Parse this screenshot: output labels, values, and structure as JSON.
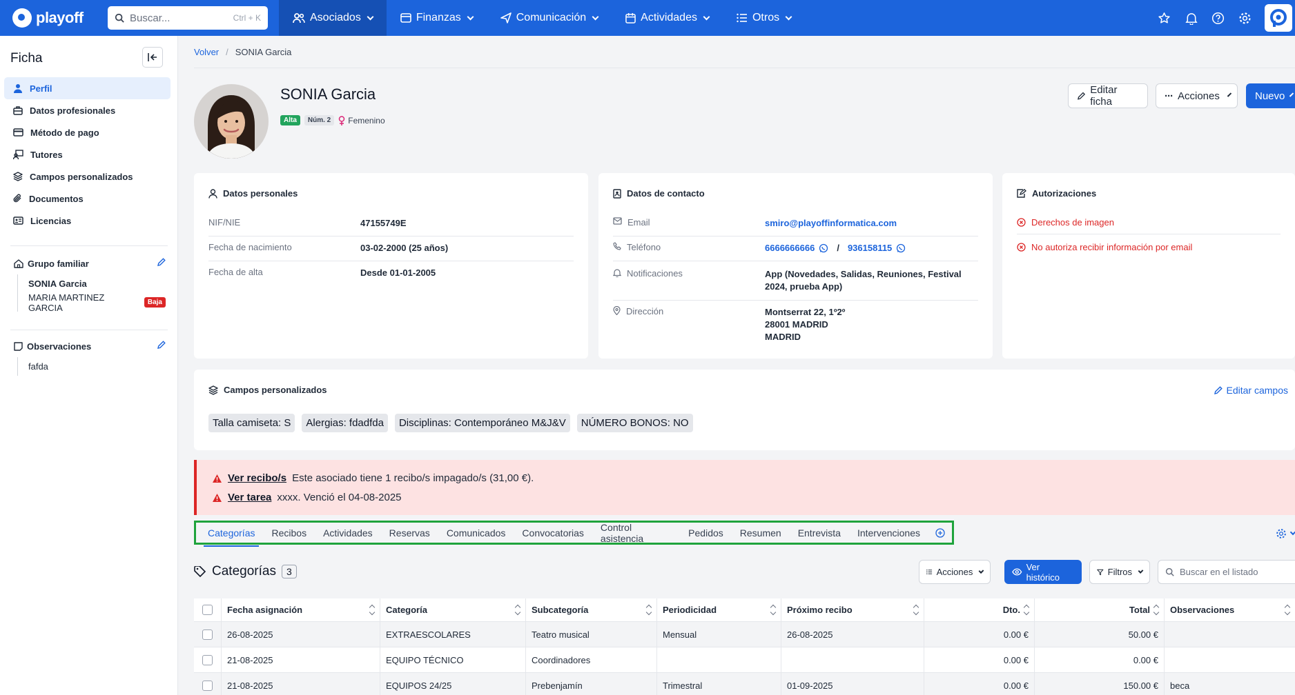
{
  "brand": {
    "name": "playoff"
  },
  "search": {
    "placeholder": "Buscar...",
    "shortcut": "Ctrl + K"
  },
  "nav": [
    {
      "label": "Asociados",
      "active": true
    },
    {
      "label": "Finanzas"
    },
    {
      "label": "Comunicación"
    },
    {
      "label": "Actividades"
    },
    {
      "label": "Otros"
    }
  ],
  "sidebar": {
    "title": "Ficha",
    "items": [
      {
        "label": "Perfil",
        "icon": "user-icon",
        "active": true
      },
      {
        "label": "Datos profesionales",
        "icon": "briefcase-icon"
      },
      {
        "label": "Método de pago",
        "icon": "credit-card-icon"
      },
      {
        "label": "Tutores",
        "icon": "tutor-icon"
      },
      {
        "label": "Campos personalizados",
        "icon": "layers-icon"
      },
      {
        "label": "Documentos",
        "icon": "paperclip-icon"
      },
      {
        "label": "Licencias",
        "icon": "id-card-icon"
      }
    ],
    "family": {
      "title": "Grupo familiar",
      "members": [
        {
          "name": "SONIA Garcia",
          "bold": true
        },
        {
          "name": "MARIA MARTINEZ GARCIA",
          "badge": "Baja"
        }
      ]
    },
    "notes": {
      "title": "Observaciones",
      "items": [
        "fafda"
      ]
    }
  },
  "breadcrumb": {
    "back": "Volver",
    "current": "SONIA Garcia"
  },
  "profile": {
    "name": "SONIA Garcia",
    "status": "Alta",
    "number": "Núm. 2",
    "gender": "Femenino"
  },
  "actions": {
    "edit": "Editar ficha",
    "more": "Acciones",
    "new": "Nuevo"
  },
  "personal": {
    "title": "Datos personales",
    "rows": [
      {
        "k": "NIF/NIE",
        "v": "47155749E"
      },
      {
        "k": "Fecha de nacimiento",
        "v": "03-02-2000 (25 años)"
      },
      {
        "k": "Fecha de alta",
        "v": "Desde 01-01-2005"
      }
    ]
  },
  "contact": {
    "title": "Datos de contacto",
    "email_k": "Email",
    "email_v": "smiro@playoffinformatica.com",
    "phone_k": "Teléfono",
    "phone1": "6666666666",
    "phone_sep": "/",
    "phone2": "936158115",
    "notif_k": "Notificaciones",
    "notif_v": "App (Novedades, Salidas, Reuniones, Festival 2024, prueba App)",
    "addr_k": "Dirección",
    "addr1": "Montserrat 22, 1º2º",
    "addr2": "28001 MADRID",
    "addr3": "MADRID"
  },
  "auth": {
    "title": "Autorizaciones",
    "items": [
      "Derechos de imagen",
      "No autoriza recibir información por email"
    ]
  },
  "custom": {
    "title": "Campos personalizados",
    "edit": "Editar campos",
    "chips": [
      "Talla camiseta: S",
      "Alergias: fdadfda",
      "Disciplinas: Contemporáneo M&J&V",
      "NÚMERO BONOS: NO"
    ]
  },
  "alerts": [
    {
      "link": "Ver recibo/s",
      "text": "Este asociado tiene 1 recibo/s impagado/s (31,00 €)."
    },
    {
      "link": "Ver tarea",
      "text": "xxxx. Venció el 04-08-2025"
    }
  ],
  "tabs": [
    "Categorías",
    "Recibos",
    "Actividades",
    "Reservas",
    "Comunicados",
    "Convocatorias",
    "Control asistencia",
    "Pedidos",
    "Resumen",
    "Entrevista",
    "Intervenciones"
  ],
  "section": {
    "title": "Categorías",
    "count": "3",
    "actions": "Acciones",
    "history": "Ver histórico",
    "filters": "Filtros",
    "search_placeholder": "Buscar en el listado"
  },
  "table": {
    "headers": [
      "Fecha asignación",
      "Categoría",
      "Subcategoría",
      "Periodicidad",
      "Próximo recibo",
      "Dto.",
      "Total",
      "Observaciones"
    ],
    "rows": [
      [
        "26-08-2025",
        "EXTRAESCOLARES",
        "Teatro musical",
        "Mensual",
        "26-08-2025",
        "0.00 €",
        "50.00 €",
        ""
      ],
      [
        "21-08-2025",
        "EQUIPO TÉCNICO",
        "Coordinadores",
        "",
        "",
        "0.00 €",
        "0.00 €",
        ""
      ],
      [
        "21-08-2025",
        "EQUIPOS 24/25",
        "Prebenjamín",
        "Trimestral",
        "01-09-2025",
        "0.00 €",
        "150.00 €",
        "beca"
      ]
    ]
  },
  "colors": {
    "primary": "#1c64dc",
    "success": "#22a45d",
    "danger": "#dc2626",
    "highlight": "#1fa33c"
  }
}
